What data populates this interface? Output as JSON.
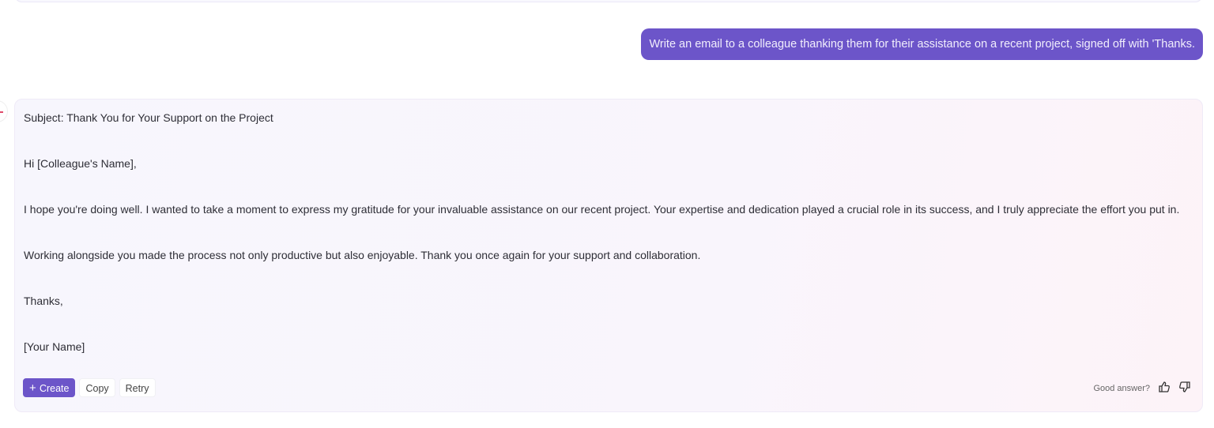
{
  "user_message": "Write an email to a colleague thanking them for their assistance on a recent project, signed off with 'Thanks.",
  "response": {
    "paragraphs": [
      "Subject: Thank You for Your Support on the Project",
      "Hi [Colleague's Name],",
      "I hope you're doing well. I wanted to take a moment to express my gratitude for your invaluable assistance on our recent project. Your expertise and dedication played a crucial role in its success, and I truly appreciate the effort you put in.",
      "Working alongside you made the process not only productive but also enjoyable. Thank you once again for your support and collaboration.",
      "Thanks,",
      "[Your Name]"
    ]
  },
  "actions": {
    "create": "Create",
    "copy": "Copy",
    "retry": "Retry"
  },
  "feedback": {
    "label": "Good answer?"
  }
}
